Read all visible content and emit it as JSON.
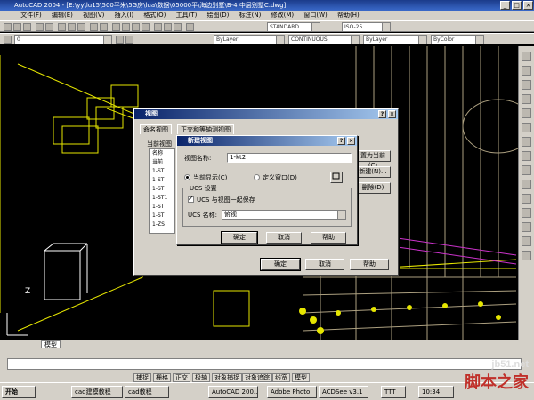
{
  "window": {
    "title": "AutoCAD 2004 - [E:\\yy\\lu15\\500平米\\5G房\\lua\\数据\\05000平\\海边别墅\\B-4 中层别墅C.dwg]",
    "min": "_",
    "max": "□",
    "close": "×"
  },
  "menu": [
    "文件(F)",
    "编辑(E)",
    "视图(V)",
    "插入(I)",
    "格式(O)",
    "工具(T)",
    "绘图(D)",
    "标注(N)",
    "修改(M)",
    "窗口(W)",
    "帮助(H)"
  ],
  "toolbar": {
    "style_combo": "STANDARD",
    "dim_combo": "ISO-25",
    "layer_combo": "0",
    "color_combo": "ByLayer",
    "linetype_combo": "CONTINUOUS",
    "lineweight_combo": "ByLayer",
    "plotstyle_combo": "ByColor"
  },
  "view_dialog": {
    "title": "视图",
    "help_btn": "?",
    "close_btn": "×",
    "tab_named": "命名视图",
    "tab_ortho": "正交和等轴测视图",
    "current_view_label": "当前视图",
    "list_header": "名称",
    "list_items": [
      "当前",
      "1-ST",
      "1-ST",
      "1-ST",
      "1-ST1",
      "1-ST",
      "1-ST",
      "1-ZS",
      "ST",
      "1-ST"
    ],
    "side_btn1": "置为当前(C)",
    "side_btn2": "新建(N)...",
    "side_btn3": "删除(D)",
    "ok": "确定",
    "cancel": "取消",
    "help": "帮助"
  },
  "new_view_dialog": {
    "title": "新建视图",
    "help_btn": "?",
    "close_btn": "×",
    "name_label": "视图名称:",
    "name_value": "1-kt2",
    "radio_current": "当前显示(C)",
    "radio_window": "定义窗口(D)",
    "ucs_group": "UCS 设置",
    "ucs_save": "UCS 与视图一起保存",
    "ucs_name_label": "UCS 名称:",
    "ucs_name_value": "俯视",
    "ok": "确定",
    "cancel": "取消",
    "help": "帮助"
  },
  "tabs": {
    "model": "模型"
  },
  "status": [
    "捕捉",
    "栅格",
    "正交",
    "极轴",
    "对象捕捉",
    "对象追踪",
    "线宽",
    "模型"
  ],
  "taskbar": {
    "start": "开始",
    "items": [
      "cad建模教程",
      "cad教程",
      "AutoCAD 200...",
      "Adobe Photo",
      "ACDSee v3.1",
      "TTT"
    ],
    "clock": "10:34"
  },
  "watermark": {
    "site": "jb51.net",
    "brand": "脚本之家"
  },
  "colors": {
    "title_blue": "#0a246a",
    "face": "#d4d0c8",
    "accent_red": "#c0302a"
  }
}
